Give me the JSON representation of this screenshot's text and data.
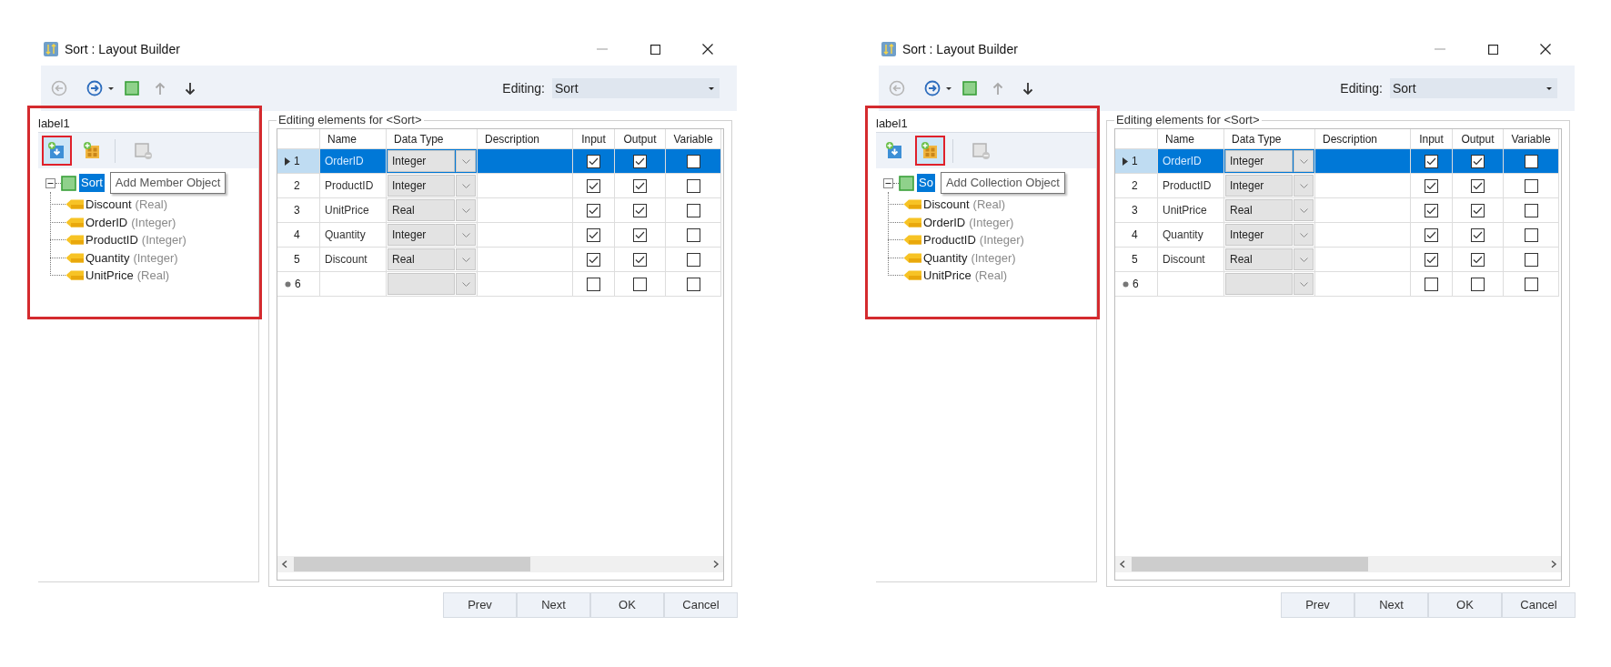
{
  "windows": [
    {
      "title": "Sort : Layout Builder",
      "editing_label": "Editing:",
      "editing_value": "Sort",
      "panel_label": "label1",
      "toolbar": [
        {
          "kind": "back",
          "disabled": true
        },
        {
          "kind": "forward",
          "disabled": false
        },
        {
          "kind": "caret",
          "disabled": false
        },
        {
          "kind": "square",
          "disabled": false
        },
        {
          "kind": "up",
          "disabled": true
        },
        {
          "kind": "down",
          "disabled": false
        }
      ],
      "tools": [
        {
          "kind": "add-member",
          "selected": true,
          "disabled": false
        },
        {
          "kind": "add-collection",
          "selected": false,
          "disabled": false
        },
        {
          "kind": "remove",
          "selected": false,
          "disabled": true
        }
      ],
      "tree": {
        "label": "Sort",
        "selected": true,
        "expanded": true,
        "children": [
          {
            "name": "Discount",
            "type": "(Real)"
          },
          {
            "name": "OrderID",
            "type": "(Integer)"
          },
          {
            "name": "ProductID",
            "type": "(Integer)"
          },
          {
            "name": "Quantity",
            "type": "(Integer)"
          },
          {
            "name": "UnitPrice",
            "type": "(Real)"
          }
        ]
      },
      "tooltip": "Add Member Object",
      "group_title": "Editing elements for <Sort>",
      "columns": [
        "Name",
        "Data Type",
        "Description",
        "Input",
        "Output",
        "Variable"
      ],
      "rows": [
        {
          "kind": "current",
          "num": "1",
          "name": "OrderID",
          "type": "Integer",
          "input": true,
          "output": true,
          "variable": false,
          "selected": true
        },
        {
          "kind": "data",
          "num": "2",
          "name": "ProductID",
          "type": "Integer",
          "input": true,
          "output": true,
          "variable": false,
          "selected": false
        },
        {
          "kind": "data",
          "num": "3",
          "name": "UnitPrice",
          "type": "Real",
          "input": true,
          "output": true,
          "variable": false,
          "selected": false
        },
        {
          "kind": "data",
          "num": "4",
          "name": "Quantity",
          "type": "Integer",
          "input": true,
          "output": true,
          "variable": false,
          "selected": false
        },
        {
          "kind": "data",
          "num": "5",
          "name": "Discount",
          "type": "Real",
          "input": true,
          "output": true,
          "variable": false,
          "selected": false
        },
        {
          "kind": "new",
          "num": "6",
          "input": false,
          "output": false,
          "variable": false,
          "selected": false
        }
      ],
      "buttons": [
        "Prev",
        "Next",
        "OK",
        "Cancel"
      ]
    },
    {
      "title": "Sort : Layout Builder",
      "editing_label": "Editing:",
      "editing_value": "Sort",
      "panel_label": "label1",
      "toolbar": [
        {
          "kind": "back",
          "disabled": true
        },
        {
          "kind": "forward",
          "disabled": false
        },
        {
          "kind": "caret",
          "disabled": false
        },
        {
          "kind": "square",
          "disabled": false
        },
        {
          "kind": "up",
          "disabled": true
        },
        {
          "kind": "down",
          "disabled": false
        }
      ],
      "tools": [
        {
          "kind": "add-member",
          "selected": false,
          "disabled": false
        },
        {
          "kind": "add-collection",
          "selected": true,
          "disabled": false
        },
        {
          "kind": "remove",
          "selected": false,
          "disabled": true
        }
      ],
      "tree": {
        "label": "So",
        "selected": true,
        "expanded": true,
        "children": [
          {
            "name": "Discount",
            "type": "(Real)"
          },
          {
            "name": "OrderID",
            "type": "(Integer)"
          },
          {
            "name": "ProductID",
            "type": "(Integer)"
          },
          {
            "name": "Quantity",
            "type": "(Integer)"
          },
          {
            "name": "UnitPrice",
            "type": "(Real)"
          }
        ]
      },
      "tooltip": "Add Collection Object",
      "group_title": "Editing elements for <Sort>",
      "columns": [
        "Name",
        "Data Type",
        "Description",
        "Input",
        "Output",
        "Variable"
      ],
      "rows": [
        {
          "kind": "current",
          "num": "1",
          "name": "OrderID",
          "type": "Integer",
          "input": true,
          "output": true,
          "variable": false,
          "selected": true
        },
        {
          "kind": "data",
          "num": "2",
          "name": "ProductID",
          "type": "Integer",
          "input": true,
          "output": true,
          "variable": false,
          "selected": false
        },
        {
          "kind": "data",
          "num": "3",
          "name": "UnitPrice",
          "type": "Real",
          "input": true,
          "output": true,
          "variable": false,
          "selected": false
        },
        {
          "kind": "data",
          "num": "4",
          "name": "Quantity",
          "type": "Integer",
          "input": true,
          "output": true,
          "variable": false,
          "selected": false
        },
        {
          "kind": "data",
          "num": "5",
          "name": "Discount",
          "type": "Real",
          "input": true,
          "output": true,
          "variable": false,
          "selected": false
        },
        {
          "kind": "new",
          "num": "6",
          "input": false,
          "output": false,
          "variable": false,
          "selected": false
        }
      ],
      "buttons": [
        "Prev",
        "Next",
        "OK",
        "Cancel"
      ]
    }
  ]
}
